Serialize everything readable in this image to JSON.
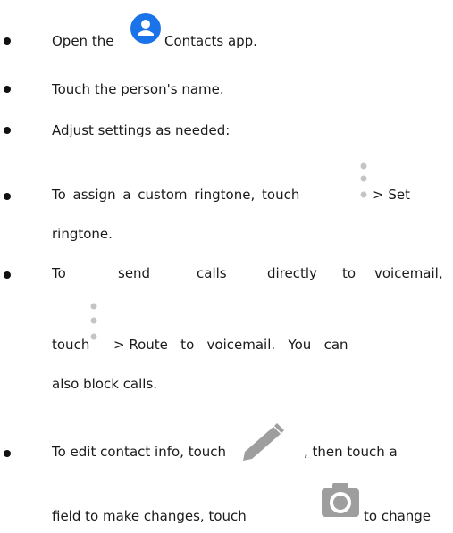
{
  "bullets": [
    {
      "before": "Open the",
      "after": "Contacts app.",
      "icon": "contacts-icon"
    },
    {
      "text": "Touch the person's name."
    },
    {
      "text": "Adjust settings as needed:"
    },
    {
      "line1": "To  assign  a custom  ringtone,  touch",
      "line1_after": "> Set",
      "line2": "ringtone.",
      "icon": "more-vertical-icon"
    },
    {
      "line1_words": [
        "To",
        "send",
        "calls",
        "directly",
        "to",
        "voicemail,"
      ],
      "line2_before": "touch",
      "line2_after": "> Route   to   voicemail.   You   can",
      "line3": "also block calls.",
      "icon": "more-vertical-icon"
    },
    {
      "line1_before": "To edit contact info, touch",
      "line1_after": ", then touch a",
      "line2_before": "field to make changes, touch",
      "line2_after": "to change",
      "icons": [
        "edit-pencil-icon",
        "camera-icon"
      ]
    }
  ],
  "colors": {
    "contacts_blue": "#1a73e8",
    "icon_gray": "#9e9e9e",
    "bullet": "#111111",
    "text": "#1a1a1a"
  }
}
